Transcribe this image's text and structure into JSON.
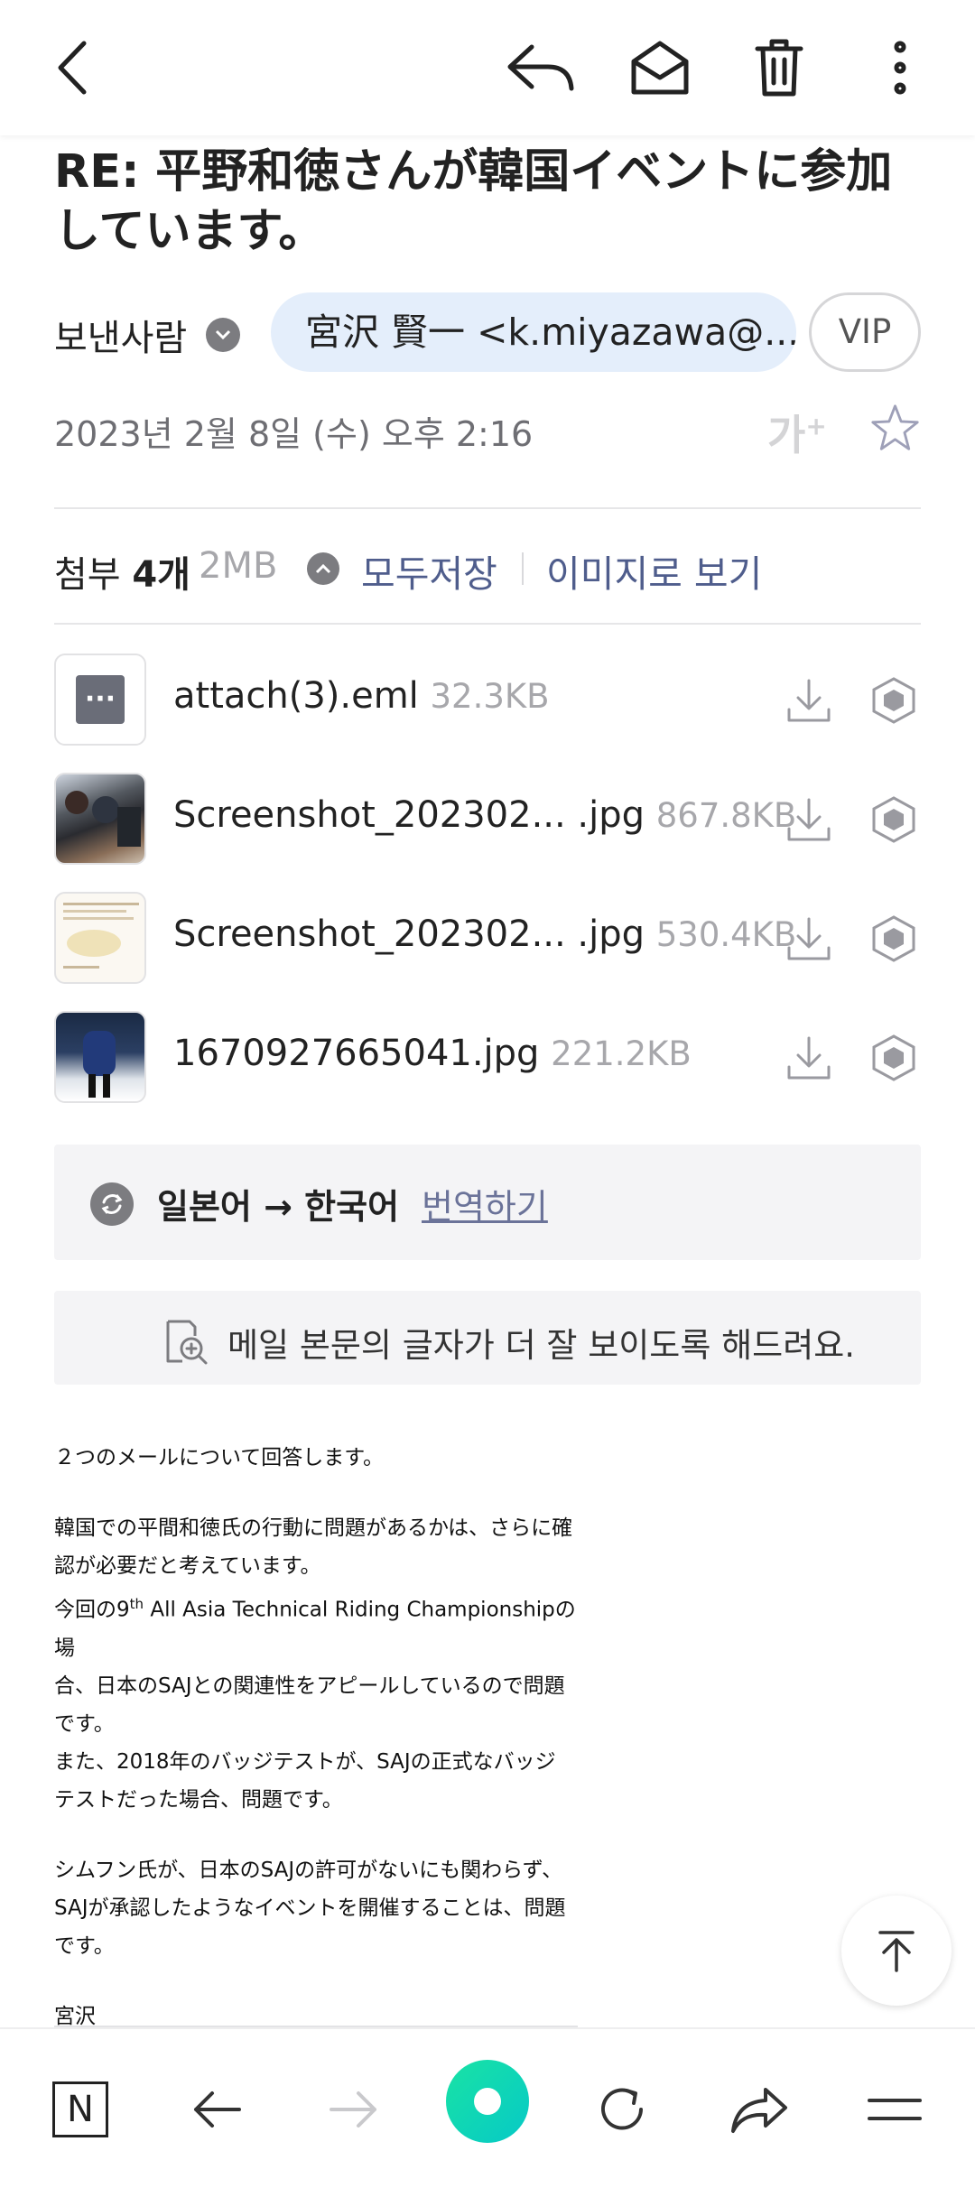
{
  "subject": "RE: 平野和徳さんが韓国イベントに参加しています。",
  "sender": {
    "label": "보낸사람",
    "name": "宮沢 賢一 <k.miyazawa@...",
    "vip": "VIP"
  },
  "date": "2023년 2월 8일 (수) 오후 2:16",
  "fontsize_label": "가",
  "attachments": {
    "label_prefix": "첨부",
    "count": "4개",
    "total_size": "2MB",
    "save_all": "모두저장",
    "view_as_image": "이미지로 보기",
    "files": [
      {
        "name": "attach(3).eml",
        "size": "32.3KB"
      },
      {
        "name": "Screenshot_202302... .jpg",
        "size": "867.8KB"
      },
      {
        "name": "Screenshot_202302... .jpg",
        "size": "530.4KB"
      },
      {
        "name": "1670927665041.jpg",
        "size": "221.2KB"
      }
    ]
  },
  "translate": {
    "languages": "일본어 → 한국어",
    "action": "번역하기"
  },
  "readable_banner": "메일 본문의 글자가 더 잘 보이도록 해드려요.",
  "body": {
    "p1": "２つのメールについて回答します。",
    "p2_l1": "韓国での平間和徳氏の行動に問題があるかは、さらに確",
    "p2_l2": "認が必要だと考えています。",
    "p2_l3a": "今回の9",
    "p2_l3sup": "th",
    "p2_l3b": " All Asia Technical Riding Championshipの場",
    "p2_l4": "合、日本のSAJとの関連性をアピールしているので問題",
    "p2_l5": "です。",
    "p2_l6": "また、2018年のバッジテストが、SAJの正式なバッジ",
    "p2_l7": "テストだった場合、問題です。",
    "p3_l1": "シムフン氏が、日本のSAJの許可がないにも関わらず、",
    "p3_l2": "SAJが承認したようなイベントを開催することは、問題",
    "p3_l3": "です。",
    "signature": "宮沢"
  },
  "bottom_nav": {
    "n_label": "N"
  }
}
